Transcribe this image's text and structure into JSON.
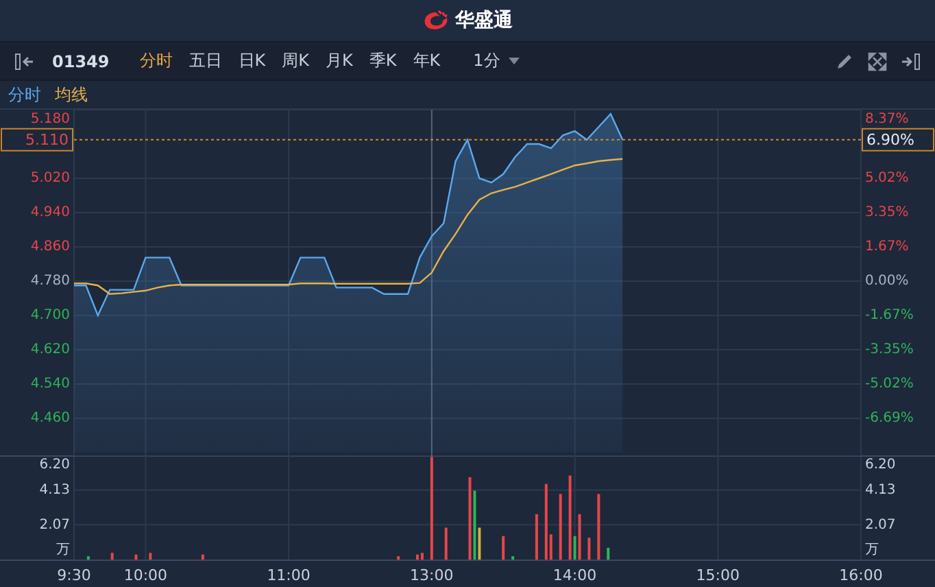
{
  "header": {
    "brand": "华盛通"
  },
  "toolbar": {
    "code": "01349",
    "tabs": [
      {
        "label": "分时",
        "selected": true
      },
      {
        "label": "五日",
        "selected": false
      },
      {
        "label": "日K",
        "selected": false
      },
      {
        "label": "周K",
        "selected": false
      },
      {
        "label": "月K",
        "selected": false
      },
      {
        "label": "季K",
        "selected": false
      },
      {
        "label": "年K",
        "selected": false
      }
    ],
    "interval": "1分"
  },
  "price_chart": {
    "right_ticks": [
      {
        "label": "8.37%",
        "color": "#e8454a"
      },
      {
        "label": "5.02%",
        "color": "#e8454a"
      },
      {
        "label": "3.35%",
        "color": "#e8454a"
      },
      {
        "label": "1.67%",
        "color": "#e8454a"
      },
      {
        "label": "0.00%",
        "color": "#aab4c3"
      },
      {
        "label": "-1.67%",
        "color": "#2fb35a"
      },
      {
        "label": "-3.35%",
        "color": "#2fb35a"
      },
      {
        "label": "-5.02%",
        "color": "#2fb35a"
      },
      {
        "label": "-6.69%",
        "color": "#2fb35a"
      }
    ],
    "current_percent": "6.90%",
    "chart_data": {
      "type": "line",
      "grid": true,
      "ylim": [
        4.38,
        5.18
      ],
      "categories": [
        null,
        null,
        null,
        null,
        null,
        null,
        null,
        null,
        null,
        null,
        null,
        null,
        null,
        null,
        null,
        null,
        null,
        null,
        null,
        null,
        null,
        null,
        null,
        null,
        null,
        null,
        null,
        null,
        null,
        null,
        null,
        null,
        null,
        null,
        null,
        null,
        null,
        null,
        null,
        null,
        null,
        null,
        null,
        null,
        null,
        null,
        null,
        null,
        null,
        null,
        null,
        null,
        null,
        null,
        null,
        null,
        null,
        null,
        null,
        null,
        null,
        null,
        null,
        null,
        null,
        null,
        null
      ],
      "series": [
        {
          "name": "分时",
          "type": "area",
          "color": "#5aa9ef",
          "values": [
            4.77,
            4.77,
            4.7,
            4.76,
            4.76,
            4.76,
            4.835,
            4.835,
            4.835,
            4.77,
            4.77,
            4.77,
            4.77,
            4.77,
            4.77,
            4.77,
            4.77,
            4.77,
            4.77,
            4.835,
            4.835,
            4.835,
            4.765,
            4.765,
            4.765,
            4.765,
            4.75,
            4.75,
            4.75,
            4.835,
            4.885,
            4.915,
            5.06,
            5.11,
            5.02,
            5.01,
            5.03,
            5.07,
            5.1,
            5.1,
            5.09,
            5.12,
            5.13,
            5.11,
            5.14,
            5.17,
            5.11,
            null,
            null,
            null,
            null,
            null,
            null,
            null,
            null,
            null,
            null,
            null,
            null,
            null,
            null,
            null,
            null,
            null,
            null,
            null,
            null
          ]
        },
        {
          "name": "均线",
          "type": "line",
          "color": "#e8b14a",
          "values": [
            4.775,
            4.775,
            4.77,
            4.75,
            4.752,
            4.755,
            4.758,
            4.765,
            4.77,
            4.772,
            4.772,
            4.772,
            4.772,
            4.772,
            4.772,
            4.772,
            4.772,
            4.772,
            4.772,
            4.775,
            4.775,
            4.775,
            4.774,
            4.774,
            4.774,
            4.774,
            4.774,
            4.774,
            4.774,
            4.776,
            4.8,
            4.85,
            4.89,
            4.935,
            4.97,
            4.985,
            4.993,
            5.0,
            5.01,
            5.02,
            5.03,
            5.04,
            5.05,
            5.055,
            5.06,
            5.063,
            5.065,
            null,
            null,
            null,
            null,
            null,
            null,
            null,
            null,
            null,
            null,
            null,
            null,
            null,
            null,
            null,
            null,
            null,
            null,
            null,
            null
          ]
        }
      ],
      "yticks": [
        {
          "value": 5.18,
          "label": "5.180"
        },
        {
          "value": 5.02,
          "label": "5.020"
        },
        {
          "value": 4.94,
          "label": "4.940"
        },
        {
          "value": 4.86,
          "label": "4.860"
        },
        {
          "value": 4.78,
          "label": "4.780"
        },
        {
          "value": 4.7,
          "label": "4.700"
        },
        {
          "value": 4.62,
          "label": "4.620"
        },
        {
          "value": 4.54,
          "label": "4.540"
        },
        {
          "value": 4.46,
          "label": "4.460"
        }
      ],
      "ref_lines": [
        {
          "axis": "y",
          "value": 5.11,
          "label": "5.110"
        }
      ]
    }
  },
  "volume_chart": {
    "right_ticks": [
      "6.20",
      "4.13",
      "2.07"
    ],
    "right_unit": "万",
    "chart_data": {
      "type": "bar",
      "grid": true,
      "ylabel": "万",
      "ylim": [
        0,
        6.2
      ],
      "categories": [
        "9:30",
        null,
        null,
        null,
        null,
        null,
        null,
        null,
        null,
        null,
        null,
        null,
        null,
        null,
        null,
        "10:00",
        null,
        null,
        null,
        null,
        null,
        null,
        null,
        null,
        null,
        null,
        null,
        null,
        null,
        null,
        null,
        null,
        null,
        null,
        null,
        null,
        null,
        null,
        null,
        null,
        null,
        null,
        null,
        null,
        null,
        "11:00",
        null,
        null,
        null,
        null,
        null,
        null,
        null,
        null,
        null,
        null,
        null,
        null,
        null,
        null,
        null,
        null,
        null,
        null,
        null,
        null,
        null,
        null,
        null,
        null,
        null,
        null,
        null,
        null,
        null,
        "13:00",
        null,
        null,
        null,
        null,
        null,
        null,
        null,
        null,
        null,
        null,
        null,
        null,
        null,
        null,
        null,
        null,
        null,
        null,
        null,
        null,
        null,
        null,
        null,
        null,
        null,
        null,
        null,
        null,
        null,
        "14:00",
        null,
        null,
        null,
        null,
        null,
        null,
        null,
        null,
        null,
        null,
        null,
        null,
        null,
        null,
        null,
        null,
        null,
        null,
        null,
        null,
        null,
        null,
        null,
        null,
        null,
        null,
        null,
        null,
        null,
        "15:00",
        null,
        null,
        null,
        null,
        null,
        null,
        null,
        null,
        null,
        null,
        null,
        null,
        null,
        null,
        null,
        null,
        null,
        null,
        null,
        null,
        null,
        null,
        null,
        null,
        null,
        null,
        null,
        null,
        null,
        "16:00"
      ],
      "series": [
        {
          "color": "#e8454a",
          "values": [
            null,
            null,
            null,
            null,
            null,
            null,
            null,
            null,
            0.4,
            null,
            null,
            null,
            null,
            0.3,
            null,
            null,
            0.4,
            null,
            null,
            null,
            null,
            null,
            null,
            null,
            null,
            null,
            null,
            0.3,
            null,
            null,
            null,
            null,
            null,
            null,
            null,
            null,
            null,
            null,
            null,
            null,
            null,
            null,
            null,
            null,
            null,
            null,
            null,
            null,
            null,
            null,
            null,
            null,
            null,
            null,
            null,
            null,
            null,
            null,
            null,
            null,
            null,
            null,
            null,
            null,
            null,
            null,
            null,
            null,
            0.2,
            null,
            null,
            null,
            0.3,
            0.4,
            null,
            6.1,
            null,
            null,
            1.9,
            null,
            null,
            null,
            null,
            4.9,
            null,
            null,
            null,
            null,
            null,
            null,
            1.4,
            null,
            null,
            null,
            null,
            null,
            null,
            2.7,
            null,
            4.5,
            1.5,
            null,
            3.9,
            null,
            5.0,
            null,
            2.7,
            null,
            1.3,
            null,
            3.9,
            null,
            null,
            null,
            null,
            null,
            null,
            null,
            null,
            null,
            null,
            null,
            null,
            null,
            null,
            null,
            null,
            null,
            null,
            null,
            null,
            null,
            null,
            null,
            null,
            null,
            null,
            null,
            null,
            null,
            null,
            null,
            null,
            null,
            null,
            null,
            null,
            null,
            null,
            null,
            null,
            null,
            null,
            null,
            null,
            null,
            null,
            null,
            null,
            null,
            null,
            null,
            null,
            null,
            null,
            null
          ]
        },
        {
          "color": "#2fb35a",
          "values": [
            null,
            null,
            null,
            0.2,
            null,
            null,
            null,
            null,
            null,
            null,
            null,
            null,
            null,
            null,
            null,
            null,
            null,
            null,
            null,
            null,
            null,
            null,
            null,
            null,
            null,
            null,
            null,
            null,
            null,
            null,
            null,
            null,
            null,
            null,
            null,
            null,
            null,
            null,
            null,
            null,
            null,
            null,
            null,
            null,
            null,
            null,
            null,
            null,
            null,
            null,
            null,
            null,
            null,
            null,
            null,
            null,
            null,
            null,
            null,
            null,
            null,
            null,
            null,
            null,
            null,
            null,
            null,
            null,
            null,
            null,
            null,
            null,
            null,
            null,
            null,
            null,
            null,
            null,
            null,
            null,
            null,
            null,
            null,
            null,
            4.1,
            null,
            null,
            null,
            null,
            null,
            null,
            null,
            0.2,
            null,
            null,
            null,
            null,
            null,
            null,
            null,
            null,
            null,
            null,
            null,
            null,
            1.4,
            null,
            null,
            null,
            null,
            null,
            null,
            0.7,
            null,
            null,
            null,
            null,
            null,
            null,
            null,
            null,
            null,
            null,
            null,
            null,
            null,
            null,
            null,
            null,
            null,
            null,
            null,
            null,
            null,
            null,
            null,
            null,
            null,
            null,
            null,
            null,
            null,
            null,
            null,
            null,
            null,
            null,
            null,
            null,
            null,
            null,
            null,
            null,
            null,
            null,
            null,
            null,
            null,
            null,
            null,
            null,
            null,
            null,
            null,
            null,
            null
          ]
        },
        {
          "color": "#c9b14a",
          "values": [
            null,
            null,
            null,
            null,
            null,
            null,
            null,
            null,
            null,
            null,
            null,
            null,
            null,
            null,
            null,
            null,
            null,
            null,
            null,
            null,
            null,
            null,
            null,
            null,
            null,
            null,
            null,
            null,
            null,
            null,
            null,
            null,
            null,
            null,
            null,
            null,
            null,
            null,
            null,
            null,
            null,
            null,
            null,
            null,
            null,
            null,
            null,
            null,
            null,
            null,
            null,
            null,
            null,
            null,
            null,
            null,
            null,
            null,
            null,
            null,
            null,
            null,
            null,
            null,
            null,
            null,
            null,
            null,
            null,
            null,
            null,
            null,
            null,
            null,
            null,
            null,
            null,
            null,
            null,
            null,
            null,
            null,
            null,
            null,
            null,
            1.9,
            null,
            null,
            null,
            null,
            null,
            null,
            null,
            null,
            null,
            null,
            null,
            null,
            null,
            null,
            null,
            null,
            null,
            null,
            null,
            null,
            null,
            null,
            null,
            null,
            null,
            null,
            null,
            null,
            null,
            null,
            null,
            null,
            null,
            null,
            null,
            null,
            null,
            null,
            null,
            null,
            null,
            null,
            null,
            null,
            null,
            null,
            null,
            null,
            null,
            null,
            null,
            null,
            null,
            null,
            null,
            null,
            null,
            null,
            null,
            null,
            null,
            null,
            null,
            null,
            null,
            null,
            null,
            null,
            null,
            null,
            null,
            null,
            null,
            null,
            null,
            null,
            null,
            null,
            null,
            null
          ]
        }
      ],
      "yticks": [
        {
          "value": 6.2,
          "label": "6.20"
        },
        {
          "value": 4.13,
          "label": "4.13"
        },
        {
          "value": 2.07,
          "label": "2.07"
        }
      ]
    }
  }
}
